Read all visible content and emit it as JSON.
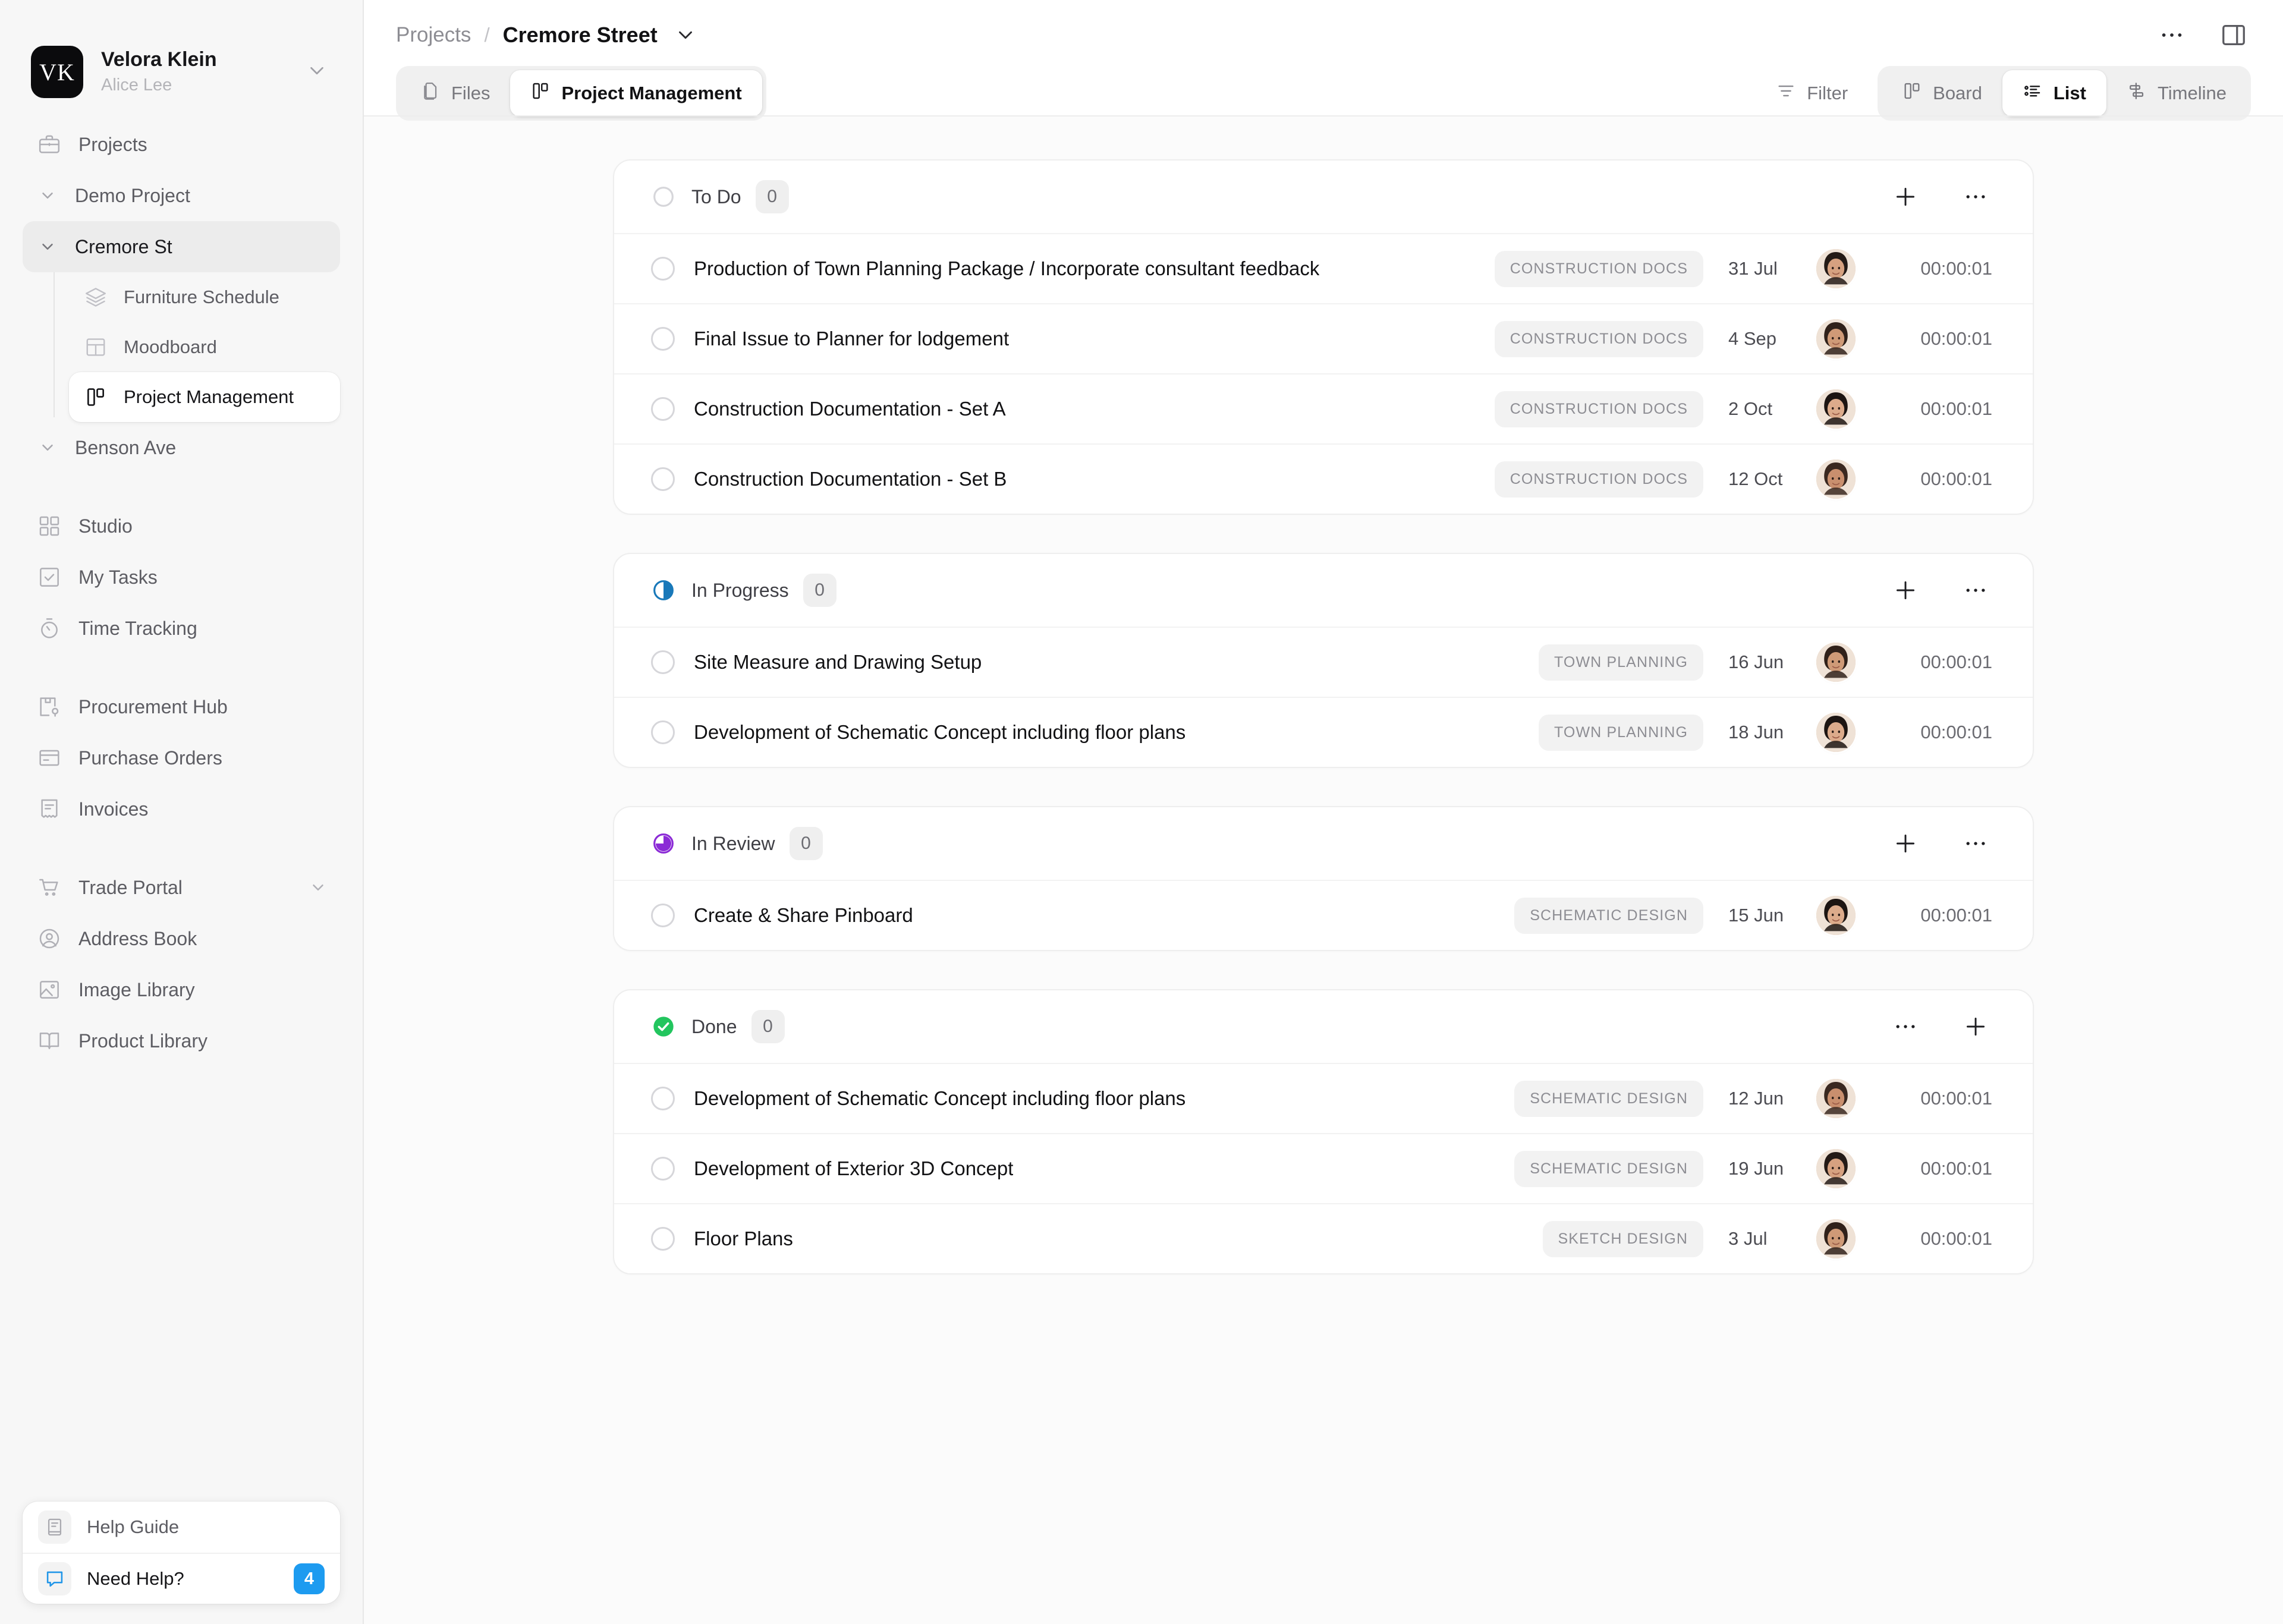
{
  "workspace": {
    "initials": "VK",
    "name": "Velora Klein",
    "user": "Alice Lee"
  },
  "sidebar": {
    "projects_label": "Projects",
    "tree": [
      {
        "label": "Demo Project",
        "expanded": true,
        "selected": false
      },
      {
        "label": "Cremore St",
        "expanded": true,
        "selected": true
      }
    ],
    "cremore_children": [
      {
        "label": "Furniture Schedule",
        "icon": "layers-icon",
        "active": false
      },
      {
        "label": "Moodboard",
        "icon": "grid-layout-icon",
        "active": false
      },
      {
        "label": "Project Management",
        "icon": "board-icon",
        "active": true
      }
    ],
    "benson": {
      "label": "Benson Ave",
      "expanded": true
    },
    "group_two": [
      {
        "label": "Studio",
        "icon": "grid-squares-icon"
      },
      {
        "label": "My Tasks",
        "icon": "checkbox-icon"
      },
      {
        "label": "Time Tracking",
        "icon": "stopwatch-icon"
      }
    ],
    "group_three": [
      {
        "label": "Procurement Hub",
        "icon": "package-pin-icon"
      },
      {
        "label": "Purchase Orders",
        "icon": "card-icon"
      },
      {
        "label": "Invoices",
        "icon": "receipt-icon"
      }
    ],
    "group_four": [
      {
        "label": "Trade Portal",
        "icon": "cart-icon",
        "has_caret": true
      },
      {
        "label": "Address Book",
        "icon": "user-circle-icon",
        "has_caret": false
      },
      {
        "label": "Image Library",
        "icon": "image-icon",
        "has_caret": false
      },
      {
        "label": "Product Library",
        "icon": "book-open-icon",
        "has_caret": false
      }
    ],
    "help": {
      "guide_label": "Help Guide",
      "need_help_label": "Need Help?",
      "need_help_count": "4",
      "badge_color": "#1d9bf0"
    }
  },
  "header": {
    "breadcrumb_root": "Projects",
    "breadcrumb_sep": "/",
    "breadcrumb_current": "Cremore Street"
  },
  "tabs": [
    {
      "label": "Files",
      "icon": "files-icon",
      "active": false
    },
    {
      "label": "Project Management",
      "icon": "board-icon",
      "active": true
    }
  ],
  "toolbar": {
    "filter_label": "Filter",
    "views": [
      {
        "label": "Board",
        "icon": "board-icon",
        "active": false
      },
      {
        "label": "List",
        "icon": "list-icon",
        "active": true
      },
      {
        "label": "Timeline",
        "icon": "timeline-icon",
        "active": false
      }
    ]
  },
  "groups": [
    {
      "title": "To Do",
      "count": "0",
      "status_icon": "circle-outline-icon",
      "status_color": "#d6d6da",
      "actions_order": [
        "plus",
        "ellipsis"
      ],
      "tasks": [
        {
          "name": "Production of Town Planning Package / Incorporate consultant feedback",
          "tag": "CONSTRUCTION DOCS",
          "date": "31 Jul",
          "timer": "00:00:01"
        },
        {
          "name": "Final Issue to Planner for lodgement",
          "tag": "CONSTRUCTION DOCS",
          "date": "4 Sep",
          "timer": "00:00:01"
        },
        {
          "name": "Construction Documentation - Set A",
          "tag": "CONSTRUCTION DOCS",
          "date": "2 Oct",
          "timer": "00:00:01"
        },
        {
          "name": "Construction Documentation - Set B",
          "tag": "CONSTRUCTION DOCS",
          "date": "12 Oct",
          "timer": "00:00:01"
        }
      ]
    },
    {
      "title": "In Progress",
      "count": "0",
      "status_icon": "half-circle-icon",
      "status_color": "#1878b9",
      "actions_order": [
        "plus",
        "ellipsis"
      ],
      "tasks": [
        {
          "name": "Site Measure and Drawing Setup",
          "tag": "TOWN PLANNING",
          "date": "16 Jun",
          "timer": "00:00:01"
        },
        {
          "name": "Development of Schematic Concept including floor plans",
          "tag": "TOWN PLANNING",
          "date": "18 Jun",
          "timer": "00:00:01"
        }
      ]
    },
    {
      "title": "In Review",
      "count": "0",
      "status_icon": "three-quarter-circle-icon",
      "status_color": "#8b2ad6",
      "actions_order": [
        "plus",
        "ellipsis"
      ],
      "tasks": [
        {
          "name": "Create & Share Pinboard",
          "tag": "SCHEMATIC DESIGN",
          "date": "15 Jun",
          "timer": "00:00:01"
        }
      ]
    },
    {
      "title": "Done",
      "count": "0",
      "status_icon": "check-circle-filled-icon",
      "status_color": "#22c55e",
      "actions_order": [
        "ellipsis",
        "plus"
      ],
      "tasks": [
        {
          "name": "Development of Schematic Concept including floor plans",
          "tag": "SCHEMATIC DESIGN",
          "date": "12 Jun",
          "timer": "00:00:01"
        },
        {
          "name": "Development of Exterior 3D Concept",
          "tag": "SCHEMATIC DESIGN",
          "date": "19 Jun",
          "timer": "00:00:01"
        },
        {
          "name": "Floor Plans",
          "tag": "SKETCH DESIGN",
          "date": "3 Jul",
          "timer": "00:00:01"
        }
      ]
    }
  ]
}
